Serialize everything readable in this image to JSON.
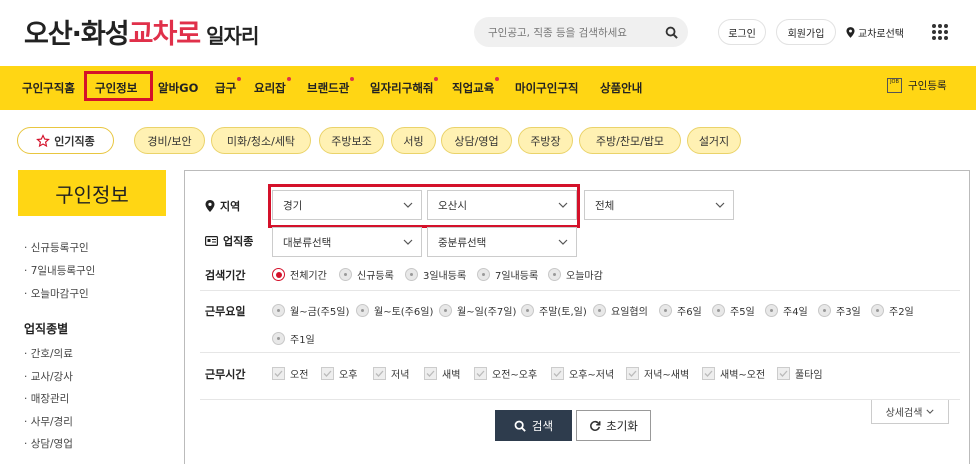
{
  "header": {
    "logo": {
      "part1": "오산·화성",
      "part2": "교차로",
      "part3": "일자리"
    },
    "search_placeholder": "구인공고, 직종 등을 검색하세요",
    "login": "로그인",
    "signup": "회원가입",
    "region_select": "교차로선택"
  },
  "nav": {
    "items": [
      {
        "label": "구인구직홈"
      },
      {
        "label": "구인정보"
      },
      {
        "label": "알바GO"
      },
      {
        "label": "급구"
      },
      {
        "label": "요리잡"
      },
      {
        "label": "브랜드관"
      },
      {
        "label": "일자리구해줘"
      },
      {
        "label": "직업교육"
      },
      {
        "label": "마이구인구직"
      },
      {
        "label": "상품안내"
      }
    ],
    "register": "구인등록",
    "register_icon_text": "JOB"
  },
  "chips": {
    "popular": "인기직종",
    "items": [
      "경비/보안",
      "미화/청소/세탁",
      "주방보조",
      "서빙",
      "상담/영업",
      "주방장",
      "주방/찬모/밥모",
      "설거지"
    ]
  },
  "sidebar": {
    "title": "구인정보",
    "links": [
      "신규등록구인",
      "7일내등록구인",
      "오늘마감구인"
    ],
    "section_title": "업직종별",
    "categories": [
      "간호/의료",
      "교사/강사",
      "매장관리",
      "사무/경리",
      "상담/영업"
    ]
  },
  "filters": {
    "region_label": "지역",
    "region_1": "경기",
    "region_2": "오산시",
    "region_3": "전체",
    "job_label": "업직종",
    "job_1": "대분류선택",
    "job_2": "중분류선택",
    "period_label": "검색기간",
    "period_options": [
      "전체기간",
      "신규등록",
      "3일내등록",
      "7일내등록",
      "오늘마감"
    ],
    "period_selected": "전체기간",
    "days_label": "근무요일",
    "days_options": [
      "월~금(주5일)",
      "월~토(주6일)",
      "월~일(주7일)",
      "주말(토,일)",
      "요일협의",
      "주6일",
      "주5일",
      "주4일",
      "주3일",
      "주2일",
      "주1일"
    ],
    "time_label": "근무시간",
    "time_options": [
      "오전",
      "오후",
      "저녁",
      "새벽",
      "오전~오후",
      "오후~저녁",
      "저녁~새벽",
      "새벽~오전",
      "풀타임"
    ],
    "search_button": "검색",
    "reset_button": "초기화",
    "detail_search": "상세검색"
  },
  "colors": {
    "brand_yellow": "#ffd614",
    "accent_red": "#d4112a",
    "logo_pink": "#e0304a",
    "button_dark": "#2e3c4d"
  }
}
